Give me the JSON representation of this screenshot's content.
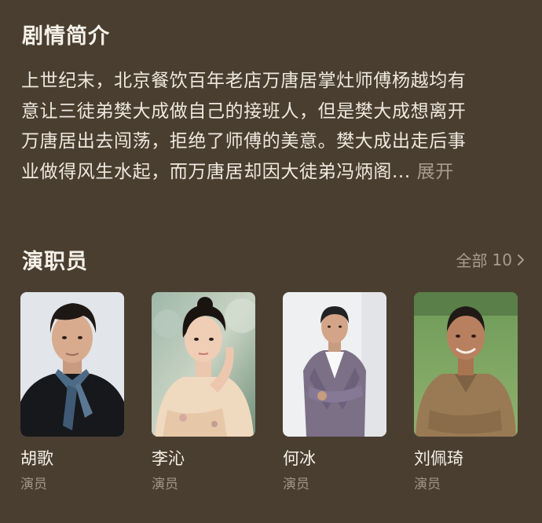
{
  "synopsis": {
    "title": "剧情简介",
    "lines": [
      "上世纪末，北京餐饮百年老店万唐居掌灶师傅杨越均有",
      "意让三徒弟樊大成做自己的接班人，但是樊大成想离开",
      "万唐居出去闯荡，拒绝了师傅的美意。樊大成出走后事",
      "业做得风生水起，而万唐居却因大徒弟冯炳阁..."
    ],
    "expand_label": "展开"
  },
  "cast": {
    "title": "演职员",
    "all_label": "全部",
    "total": "10",
    "members": [
      {
        "name": "胡歌",
        "role": "演员"
      },
      {
        "name": "李沁",
        "role": "演员"
      },
      {
        "name": "何冰",
        "role": "演员"
      },
      {
        "name": "刘佩琦",
        "role": "演员"
      }
    ]
  },
  "colors": {
    "background": "#4a3e31",
    "primary_text": "#f6f1e9",
    "secondary_text": "#a79c8e"
  }
}
